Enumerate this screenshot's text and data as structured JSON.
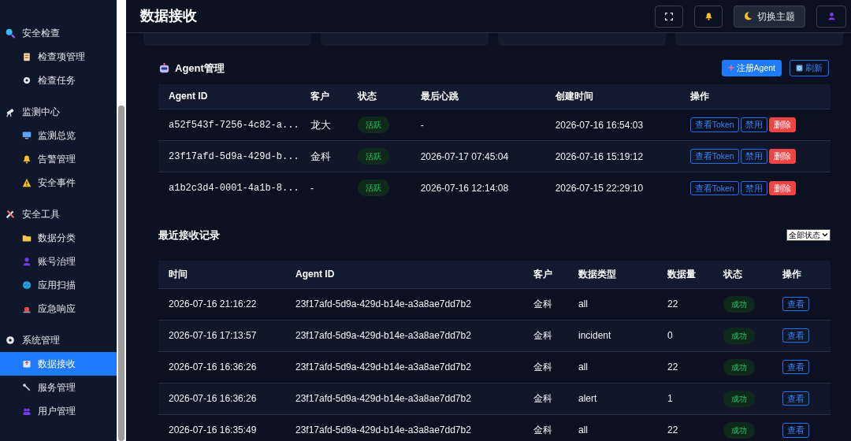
{
  "sidebar": {
    "groups": [
      {
        "label": "安全检查",
        "items": [
          {
            "label": "检查项管理",
            "selected": false
          },
          {
            "label": "检查任务",
            "selected": false
          }
        ]
      },
      {
        "label": "监测中心",
        "items": [
          {
            "label": "监测总览",
            "selected": false
          },
          {
            "label": "告警管理",
            "selected": false
          },
          {
            "label": "安全事件",
            "selected": false
          }
        ]
      },
      {
        "label": "安全工具",
        "items": [
          {
            "label": "数据分类",
            "selected": false
          },
          {
            "label": "账号治理",
            "selected": false
          },
          {
            "label": "应用扫描",
            "selected": false
          },
          {
            "label": "应急响应",
            "selected": false
          }
        ]
      },
      {
        "label": "系统管理",
        "items": [
          {
            "label": "数据接收",
            "selected": true
          },
          {
            "label": "服务管理",
            "selected": false
          },
          {
            "label": "用户管理",
            "selected": false
          }
        ]
      }
    ]
  },
  "header": {
    "title": "数据接收",
    "buttons": [
      {
        "kind": "fullscreen"
      },
      {
        "kind": "bell"
      },
      {
        "kind": "theme",
        "label": "切换主题"
      },
      {
        "kind": "user"
      }
    ]
  },
  "agents": {
    "title": "Agent管理",
    "buttons": [
      {
        "kind": "primary",
        "label": "注册Agent"
      },
      {
        "kind": "outline",
        "label": "刷新"
      }
    ],
    "columns": [
      "Agent ID",
      "客户",
      "状态",
      "最后心跳",
      "创建时间",
      "操作"
    ],
    "rows": [
      {
        "id": "a52f543f-7256-4c82-a...",
        "customer": "龙大",
        "status": "活跃",
        "heartbeat": "-",
        "created": "2026-07-16 16:54:03",
        "actions": [
          {
            "kind": "outline",
            "label": "查看Token"
          },
          {
            "kind": "outline",
            "label": "禁用"
          },
          {
            "kind": "danger",
            "label": "删除"
          }
        ]
      },
      {
        "id": "23f17afd-5d9a-429d-b...",
        "customer": "金科",
        "status": "活跃",
        "heartbeat": "2026-07-17 07:45:04",
        "created": "2026-07-16 15:19:12",
        "actions": [
          {
            "kind": "outline",
            "label": "查看Token"
          },
          {
            "kind": "outline",
            "label": "禁用"
          },
          {
            "kind": "danger",
            "label": "删除"
          }
        ]
      },
      {
        "id": "a1b2c3d4-0001-4a1b-8...",
        "customer": "-",
        "status": "活跃",
        "heartbeat": "2026-07-16 12:14:08",
        "created": "2026-07-15 22:29:10",
        "actions": [
          {
            "kind": "outline",
            "label": "查看Token"
          },
          {
            "kind": "outline",
            "label": "禁用"
          },
          {
            "kind": "danger",
            "label": "删除"
          }
        ]
      }
    ]
  },
  "records": {
    "title": "最近接收记录",
    "filter": {
      "value": "全部状态"
    },
    "columns": [
      "时间",
      "Agent ID",
      "客户",
      "数据类型",
      "数据量",
      "状态",
      "操作"
    ],
    "rows": [
      {
        "time": "2026-07-16 21:16:22",
        "agent_id": "23f17afd-5d9a-429d-b14e-a3a8ae7dd7b2",
        "customer": "金科",
        "data_type": "all",
        "amount": "22",
        "status": "成功",
        "action": "查看"
      },
      {
        "time": "2026-07-16 17:13:57",
        "agent_id": "23f17afd-5d9a-429d-b14e-a3a8ae7dd7b2",
        "customer": "金科",
        "data_type": "incident",
        "amount": "0",
        "status": "成功",
        "action": "查看"
      },
      {
        "time": "2026-07-16 16:36:26",
        "agent_id": "23f17afd-5d9a-429d-b14e-a3a8ae7dd7b2",
        "customer": "金科",
        "data_type": "all",
        "amount": "22",
        "status": "成功",
        "action": "查看"
      },
      {
        "time": "2026-07-16 16:36:26",
        "agent_id": "23f17afd-5d9a-429d-b14e-a3a8ae7dd7b2",
        "customer": "金科",
        "data_type": "alert",
        "amount": "1",
        "status": "成功",
        "action": "查看"
      },
      {
        "time": "2026-07-16 16:35:49",
        "agent_id": "23f17afd-5d9a-429d-b14e-a3a8ae7dd7b2",
        "customer": "金科",
        "data_type": "all",
        "amount": "22",
        "status": "成功",
        "action": "查看"
      }
    ]
  }
}
